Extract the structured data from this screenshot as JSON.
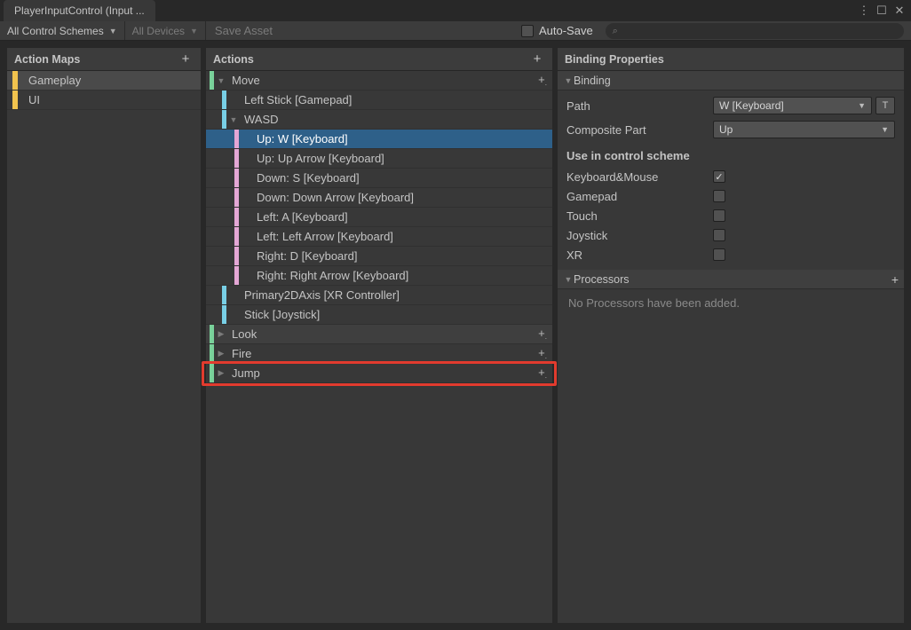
{
  "tab": {
    "title": "PlayerInputControl (Input ..."
  },
  "toolbar": {
    "schemes": "All Control Schemes",
    "devices": "All Devices",
    "save": "Save Asset",
    "autosave": "Auto-Save"
  },
  "actionMaps": {
    "header": "Action Maps",
    "items": [
      "Gameplay",
      "UI"
    ],
    "selected": 0
  },
  "actions": {
    "header": "Actions",
    "tree": [
      {
        "type": "action",
        "label": "Move",
        "expanded": true,
        "add": "down"
      },
      {
        "type": "comp",
        "label": "Left Stick [Gamepad]",
        "indent": 1
      },
      {
        "type": "comp",
        "label": "WASD",
        "indent": 1,
        "expanded": true
      },
      {
        "type": "bind",
        "label": "Up: W [Keyboard]",
        "indent": 2,
        "selected": true
      },
      {
        "type": "bind",
        "label": "Up: Up Arrow [Keyboard]",
        "indent": 2
      },
      {
        "type": "bind",
        "label": "Down: S [Keyboard]",
        "indent": 2
      },
      {
        "type": "bind",
        "label": "Down: Down Arrow [Keyboard]",
        "indent": 2
      },
      {
        "type": "bind",
        "label": "Left: A [Keyboard]",
        "indent": 2
      },
      {
        "type": "bind",
        "label": "Left: Left Arrow [Keyboard]",
        "indent": 2
      },
      {
        "type": "bind",
        "label": "Right: D [Keyboard]",
        "indent": 2
      },
      {
        "type": "bind",
        "label": "Right: Right Arrow [Keyboard]",
        "indent": 2
      },
      {
        "type": "comp",
        "label": "Primary2DAxis [XR Controller]",
        "indent": 1
      },
      {
        "type": "comp",
        "label": "Stick [Joystick]",
        "indent": 1
      },
      {
        "type": "action",
        "label": "Look",
        "expanded": false,
        "add": "down",
        "bump": true
      },
      {
        "type": "action",
        "label": "Fire",
        "expanded": false,
        "add": "down"
      },
      {
        "type": "action",
        "label": "Jump",
        "expanded": false,
        "add": "down",
        "highlight": true
      }
    ]
  },
  "properties": {
    "header": "Binding Properties",
    "binding_section": "Binding",
    "path_label": "Path",
    "path_value": "W [Keyboard]",
    "t_button": "T",
    "composite_label": "Composite Part",
    "composite_value": "Up",
    "scheme_title": "Use in control scheme",
    "schemes": [
      {
        "name": "Keyboard&Mouse",
        "checked": true
      },
      {
        "name": "Gamepad",
        "checked": false
      },
      {
        "name": "Touch",
        "checked": false
      },
      {
        "name": "Joystick",
        "checked": false
      },
      {
        "name": "XR",
        "checked": false
      }
    ],
    "processors_section": "Processors",
    "processors_empty": "No Processors have been added."
  }
}
